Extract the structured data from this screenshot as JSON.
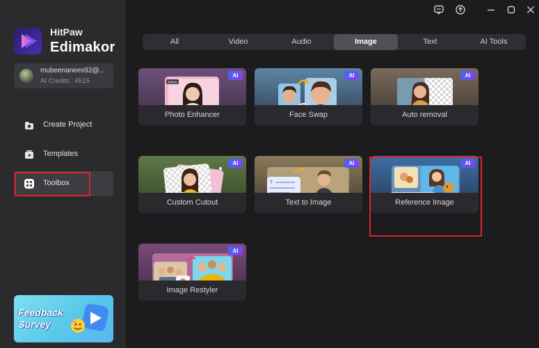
{
  "window": {
    "icons": [
      "chat-icon",
      "upload-icon",
      "minimize-icon",
      "maximize-icon",
      "close-icon"
    ]
  },
  "brand": {
    "line1": "HitPaw",
    "line2": "Edimakor"
  },
  "user": {
    "name": "mubeenanees92@...",
    "credits": "AI Credits : 6515"
  },
  "sidebar": {
    "items": [
      {
        "label": "Create Project",
        "icon": "folder-plus-icon"
      },
      {
        "label": "Templates",
        "icon": "templates-icon"
      },
      {
        "label": "Toolbox",
        "icon": "toolbox-icon",
        "active": true
      }
    ]
  },
  "feedback": {
    "line1": "Feedback",
    "line2": "Survey"
  },
  "tabs": [
    {
      "label": "All"
    },
    {
      "label": "Video"
    },
    {
      "label": "Audio"
    },
    {
      "label": "Image",
      "active": true
    },
    {
      "label": "Text"
    },
    {
      "label": "AI Tools"
    }
  ],
  "tools": [
    {
      "label": "Photo Enhancer",
      "badge": "AI"
    },
    {
      "label": "Face Swap",
      "badge": "AI"
    },
    {
      "label": "Auto removal",
      "badge": "AI"
    },
    {
      "label": "Custom Cutout",
      "badge": "AI"
    },
    {
      "label": "Text to Image",
      "badge": "AI"
    },
    {
      "label": "Reference Image",
      "badge": "AI",
      "highlighted": true
    },
    {
      "label": "Image Restyler",
      "badge": "AI"
    }
  ],
  "thumb_labels": {
    "before": "Before",
    "after": "After"
  },
  "colors": {
    "highlight": "#d9262c",
    "accent": "#6b3cf0",
    "background": "#1c1c1f",
    "sidebar": "#2b2b2e"
  }
}
